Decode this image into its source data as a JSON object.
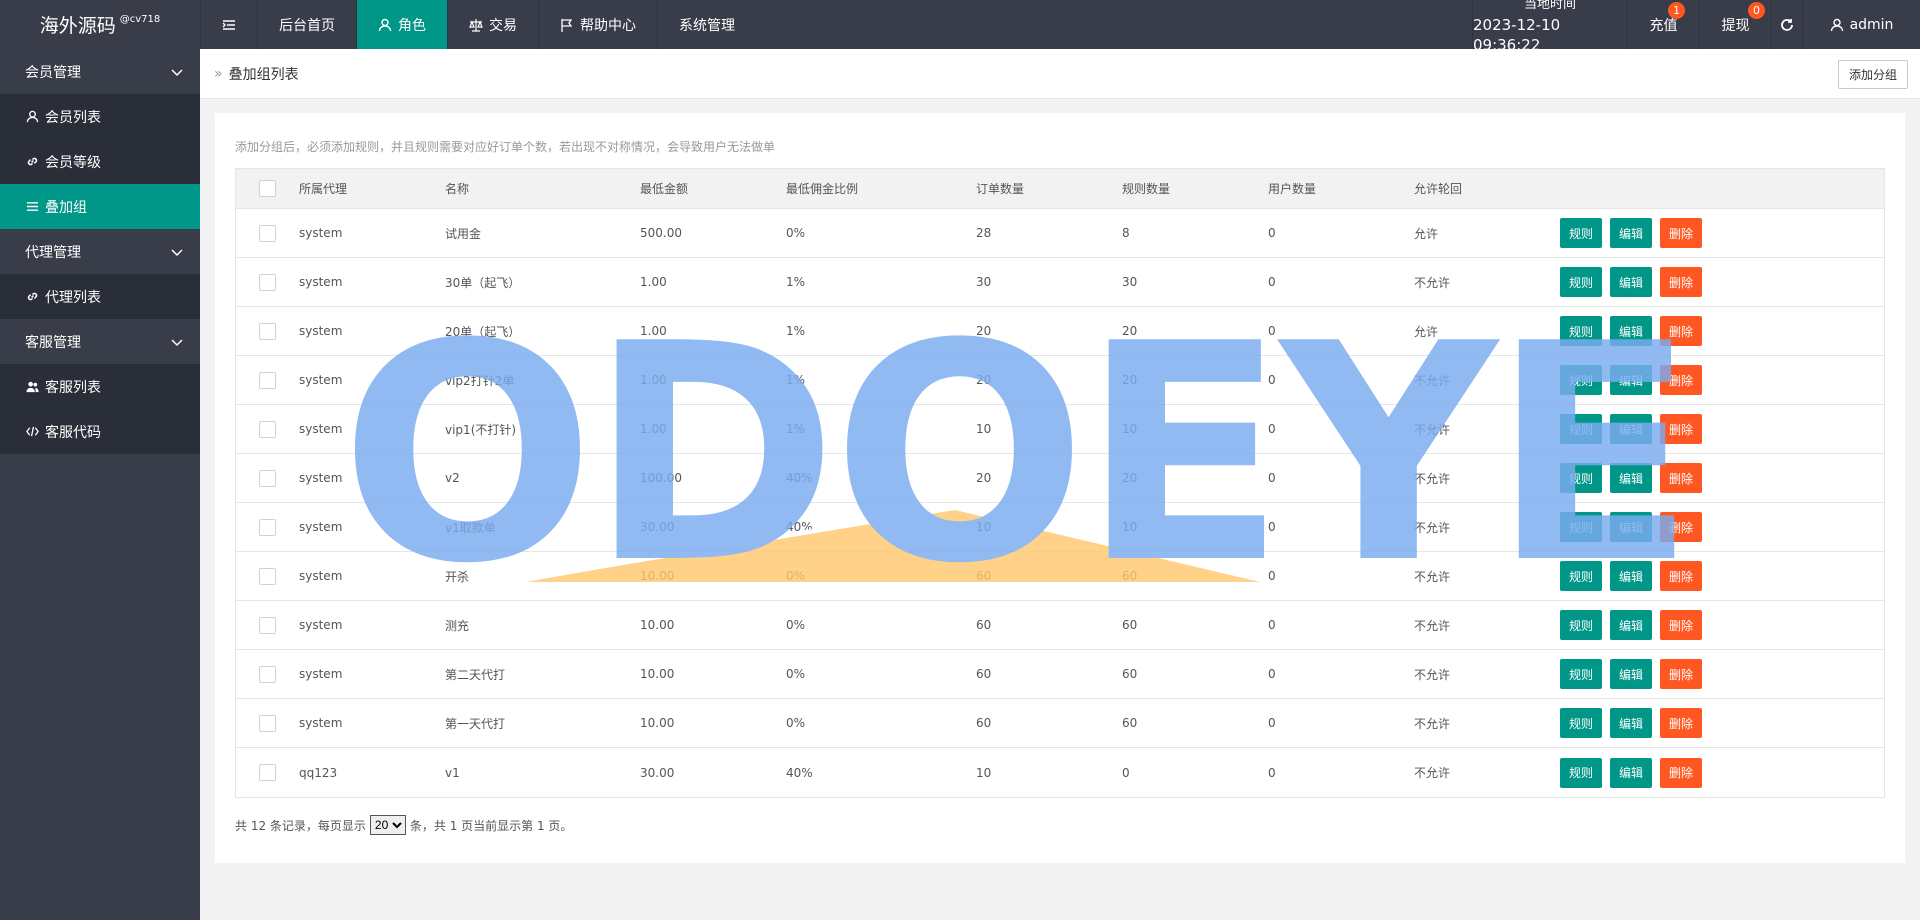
{
  "topbar": {
    "logo": "海外源码",
    "logo_sup": "@cv718",
    "nav": [
      {
        "label": "后台首页",
        "icon": "home-icon"
      },
      {
        "label": "角色",
        "icon": "user-icon"
      },
      {
        "label": "交易",
        "icon": "scale-icon"
      },
      {
        "label": "帮助中心",
        "icon": "flag-icon"
      },
      {
        "label": "系统管理",
        "icon": ""
      }
    ],
    "time_label": "当地时间",
    "time_value": "2023-12-10 09:36:22",
    "recharge_label": "充值",
    "recharge_badge": "1",
    "withdraw_label": "提现",
    "withdraw_badge": "0",
    "user_label": "admin"
  },
  "sidebar": {
    "groups": [
      {
        "label": "会员管理",
        "items": [
          {
            "label": "会员列表"
          },
          {
            "label": "会员等级"
          },
          {
            "label": "叠加组"
          }
        ]
      },
      {
        "label": "代理管理",
        "items": [
          {
            "label": "代理列表"
          }
        ]
      },
      {
        "label": "客服管理",
        "items": [
          {
            "label": "客服列表"
          },
          {
            "label": "客服代码"
          }
        ]
      }
    ]
  },
  "main": {
    "breadcrumb": "叠加组列表",
    "add_button": "添加分组",
    "notice": "添加分组后，必须添加规则，并且规则需要对应好订单个数，若出现不对称情况，会导致用户无法做单",
    "columns": [
      "所属代理",
      "名称",
      "最低金额",
      "最低佣金比例",
      "订单数量",
      "规则数量",
      "用户数量",
      "允许轮回"
    ],
    "rows": [
      [
        "system",
        "试用金",
        "500.00",
        "0%",
        "28",
        "8",
        "0",
        "允许"
      ],
      [
        "system",
        "30单（起飞）",
        "1.00",
        "1%",
        "30",
        "30",
        "0",
        "不允许"
      ],
      [
        "system",
        "20单（起飞）",
        "1.00",
        "1%",
        "20",
        "20",
        "0",
        "允许"
      ],
      [
        "system",
        "vip2打针2单",
        "1.00",
        "1%",
        "20",
        "20",
        "0",
        "不允许"
      ],
      [
        "system",
        "vip1(不打针)",
        "1.00",
        "1%",
        "10",
        "10",
        "0",
        "不允许"
      ],
      [
        "system",
        "v2",
        "100.00",
        "40%",
        "20",
        "20",
        "0",
        "不允许"
      ],
      [
        "system",
        "v1取款单",
        "30.00",
        "40%",
        "10",
        "10",
        "0",
        "不允许"
      ],
      [
        "system",
        "开杀",
        "10.00",
        "0%",
        "60",
        "60",
        "0",
        "不允许"
      ],
      [
        "system",
        "测充",
        "10.00",
        "0%",
        "60",
        "60",
        "0",
        "不允许"
      ],
      [
        "system",
        "第二天代打",
        "10.00",
        "0%",
        "60",
        "60",
        "0",
        "不允许"
      ],
      [
        "system",
        "第一天代打",
        "10.00",
        "0%",
        "60",
        "60",
        "0",
        "不允许"
      ],
      [
        "qq123",
        "v1",
        "30.00",
        "40%",
        "10",
        "0",
        "0",
        "不允许"
      ]
    ],
    "actions": {
      "rule": "规则",
      "edit": "编辑",
      "delete": "删除"
    },
    "pager": {
      "prefix": "共 12 条记录，每页显示",
      "page_size": "20",
      "suffix": "条，共 1 页当前显示第 1 页。"
    }
  },
  "watermark": "ODOEYE",
  "colors": {
    "accent": "#009688",
    "danger": "#ff5722",
    "dark": "#393d49"
  }
}
